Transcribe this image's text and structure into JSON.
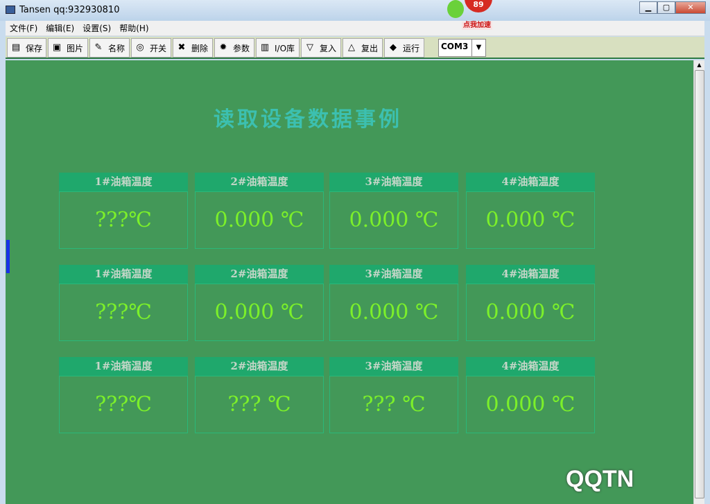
{
  "window": {
    "title": "Tansen qq:932930810",
    "badge": "89",
    "speed_label": "点我加速"
  },
  "menu": [
    "文件(F)",
    "编辑(E)",
    "设置(S)",
    "帮助(H)"
  ],
  "toolbar": [
    {
      "label": "保存",
      "icon": "save-icon",
      "glyph": "▤"
    },
    {
      "label": "图片",
      "icon": "picture-icon",
      "glyph": "▣"
    },
    {
      "label": "名称",
      "icon": "name-icon",
      "glyph": "✎"
    },
    {
      "label": "开关",
      "icon": "switch-icon",
      "glyph": "◎"
    },
    {
      "label": "删除",
      "icon": "delete-icon",
      "glyph": "✖"
    },
    {
      "label": "参数",
      "icon": "gear-icon",
      "glyph": "✹"
    },
    {
      "label": "I/O库",
      "icon": "database-icon",
      "glyph": "▥"
    },
    {
      "label": "复入",
      "icon": "triangle-down-icon",
      "glyph": "▽"
    },
    {
      "label": "复出",
      "icon": "triangle-up-icon",
      "glyph": "△"
    },
    {
      "label": "运行",
      "icon": "run-icon",
      "glyph": "◆"
    }
  ],
  "port": {
    "selected": "COM3"
  },
  "main": {
    "heading": "读取设备数据事例",
    "rows": [
      [
        {
          "label": "1#油箱温度",
          "value": "???℃"
        },
        {
          "label": "2#油箱温度",
          "value": "0.000 ℃"
        },
        {
          "label": "3#油箱温度",
          "value": "0.000 ℃"
        },
        {
          "label": "4#油箱温度",
          "value": "0.000 ℃"
        }
      ],
      [
        {
          "label": "1#油箱温度",
          "value": "???℃"
        },
        {
          "label": "2#油箱温度",
          "value": "0.000 ℃"
        },
        {
          "label": "3#油箱温度",
          "value": "0.000 ℃"
        },
        {
          "label": "4#油箱温度",
          "value": "0.000 ℃"
        }
      ],
      [
        {
          "label": "1#油箱温度",
          "value": "???℃"
        },
        {
          "label": "2#油箱温度",
          "value": "??? ℃"
        },
        {
          "label": "3#油箱温度",
          "value": "??? ℃"
        },
        {
          "label": "4#油箱温度",
          "value": "0.000 ℃"
        }
      ]
    ]
  },
  "watermark": "QQTN"
}
